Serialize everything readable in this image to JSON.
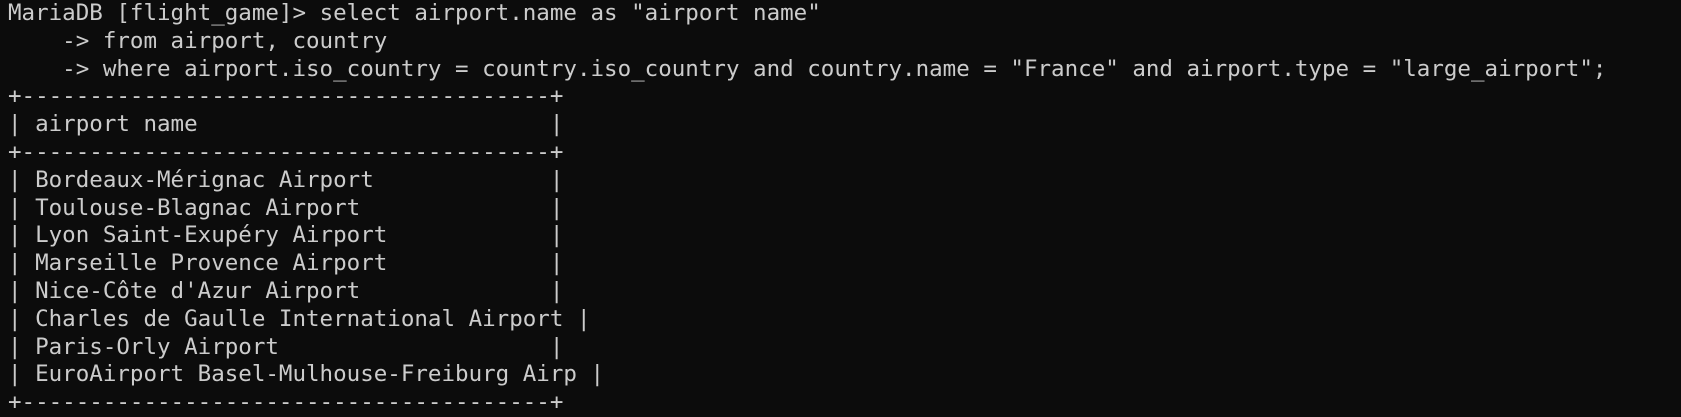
{
  "terminal": {
    "prompt": "MariaDB [flight_game]> ",
    "query": [
      "select airport.name as \"airport name\"",
      "    -> from airport, country",
      "    -> where airport.iso_country = country.iso_country and country.name = \"France\" and airport.type = \"large_airport\";"
    ],
    "result": {
      "border": "+---------------------------------------+",
      "header": "| airport name                          |",
      "rows": [
        "| Bordeaux-Mérignac Airport             |",
        "| Toulouse-Blagnac Airport              |",
        "| Lyon Saint-Exupéry Airport            |",
        "| Marseille Provence Airport            |",
        "| Nice-Côte d'Azur Airport              |",
        "| Charles de Gaulle International Airport |",
        "| Paris-Orly Airport                    |",
        "| EuroAirport Basel-Mulhouse-Freiburg Airp |"
      ]
    }
  },
  "colors": {
    "background": "#0c0c0c",
    "text": "#cccccc"
  }
}
